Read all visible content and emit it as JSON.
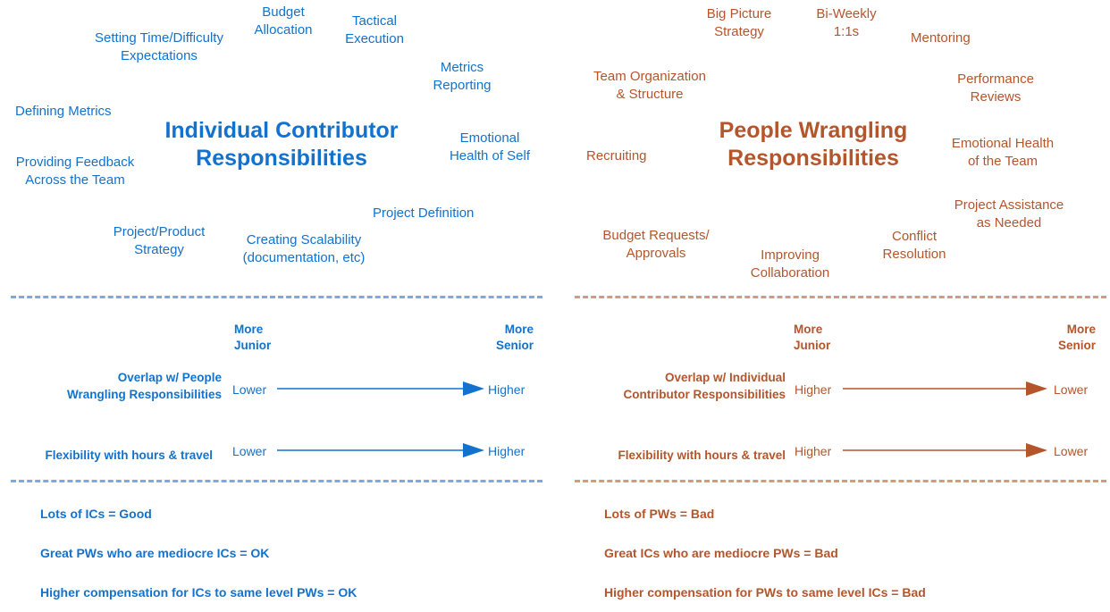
{
  "colors": {
    "ic_accent": "#1272CE",
    "pw_accent": "#B4552B",
    "ic_divider": "#7CA9E4",
    "pw_divider": "#D49A7C",
    "background": "#FFFFFF"
  },
  "panels": {
    "ic": {
      "title": "Individual Contributor\nResponsibilities",
      "cloud_words": [
        {
          "text": "Setting Time/Difficulty\nExpectations",
          "size": 15
        },
        {
          "text": "Budget\nAllocation",
          "size": 15
        },
        {
          "text": "Tactical\nExecution",
          "size": 15
        },
        {
          "text": "Metrics\nReporting",
          "size": 15
        },
        {
          "text": "Defining Metrics",
          "size": 15
        },
        {
          "text": "Emotional\nHealth of Self",
          "size": 15
        },
        {
          "text": "Providing Feedback\nAcross the Team",
          "size": 15
        },
        {
          "text": "Project Definition",
          "size": 15
        },
        {
          "text": "Project/Product\nStrategy",
          "size": 15
        },
        {
          "text": "Creating Scalability\n(documentation, etc)",
          "size": 15
        }
      ],
      "spectrum": {
        "axis_left": "More\nJunior",
        "axis_right": "More\nSenior",
        "rows": [
          {
            "label": "Overlap w/ People\nWrangling Responsibilities",
            "start": "Lower",
            "end": "Higher",
            "direction": "right"
          },
          {
            "label": "Flexibility with hours & travel",
            "start": "Lower",
            "end": "Higher",
            "direction": "right"
          }
        ]
      },
      "conclusions": [
        "Lots of ICs = Good",
        "Great PWs who are mediocre ICs = OK",
        "Higher compensation for ICs to same level PWs = OK"
      ]
    },
    "pw": {
      "title": "People Wrangling\nResponsibilities",
      "cloud_words": [
        {
          "text": "Big Picture\nStrategy",
          "size": 15
        },
        {
          "text": "Bi-Weekly\n1:1s",
          "size": 15
        },
        {
          "text": "Mentoring",
          "size": 15
        },
        {
          "text": "Team Organization\n& Structure",
          "size": 15
        },
        {
          "text": "Performance\nReviews",
          "size": 15
        },
        {
          "text": "Recruiting",
          "size": 15
        },
        {
          "text": "Emotional Health\nof the Team",
          "size": 15
        },
        {
          "text": "Project Assistance\nas Needed",
          "size": 15
        },
        {
          "text": "Budget Requests/\nApprovals",
          "size": 15
        },
        {
          "text": "Improving\nCollaboration",
          "size": 15
        },
        {
          "text": "Conflict\nResolution",
          "size": 15
        }
      ],
      "spectrum": {
        "axis_left": "More\nJunior",
        "axis_right": "More\nSenior",
        "rows": [
          {
            "label": "Overlap w/ Individual\nContributor Responsibilities",
            "start": "Higher",
            "end": "Lower",
            "direction": "right"
          },
          {
            "label": "Flexibility with hours & travel",
            "start": "Higher",
            "end": "Lower",
            "direction": "right"
          }
        ]
      },
      "conclusions": [
        "Lots of PWs = Bad",
        "Great ICs who are mediocre PWs = Bad",
        "Higher compensation for PWs to same level ICs = Bad"
      ]
    }
  }
}
